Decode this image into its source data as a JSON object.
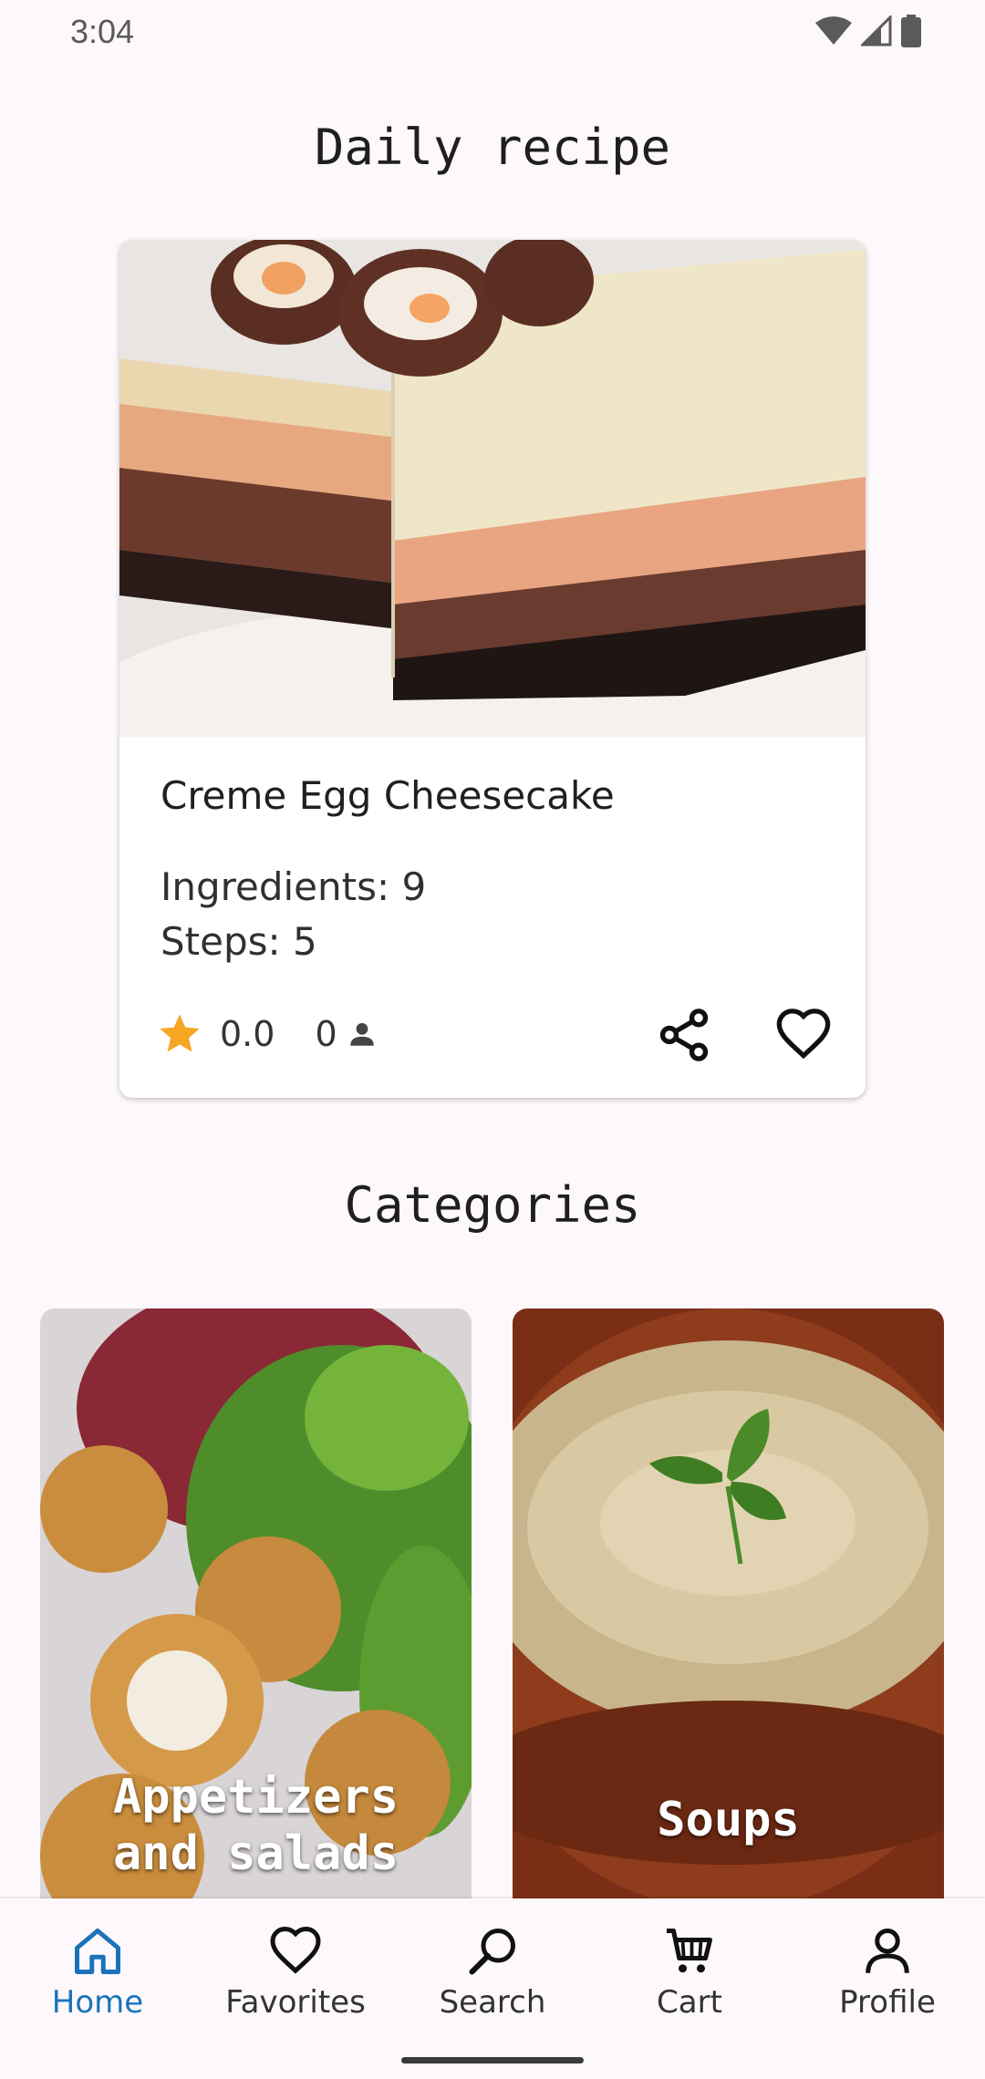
{
  "status_bar": {
    "time": "3:04"
  },
  "daily": {
    "title": "Daily recipe",
    "recipe": {
      "name": "Creme Egg Cheesecake",
      "ingredients": "Ingredients: 9",
      "steps": "Steps: 5",
      "rating": "0.0",
      "reviews": "0"
    }
  },
  "categories": {
    "title": "Categories",
    "items": [
      {
        "label_line1": "Appetizers",
        "label_line2": "and salads"
      },
      {
        "label": "Soups"
      }
    ]
  },
  "nav": {
    "items": [
      {
        "label": "Home",
        "icon": "home-icon",
        "active": true
      },
      {
        "label": "Favorites",
        "icon": "heart-icon"
      },
      {
        "label": "Search",
        "icon": "search-icon"
      },
      {
        "label": "Cart",
        "icon": "cart-icon"
      },
      {
        "label": "Profile",
        "icon": "person-icon"
      }
    ]
  },
  "colors": {
    "accent": "#1a73b8",
    "star": "#f5a623",
    "background": "#fdf8fb"
  }
}
